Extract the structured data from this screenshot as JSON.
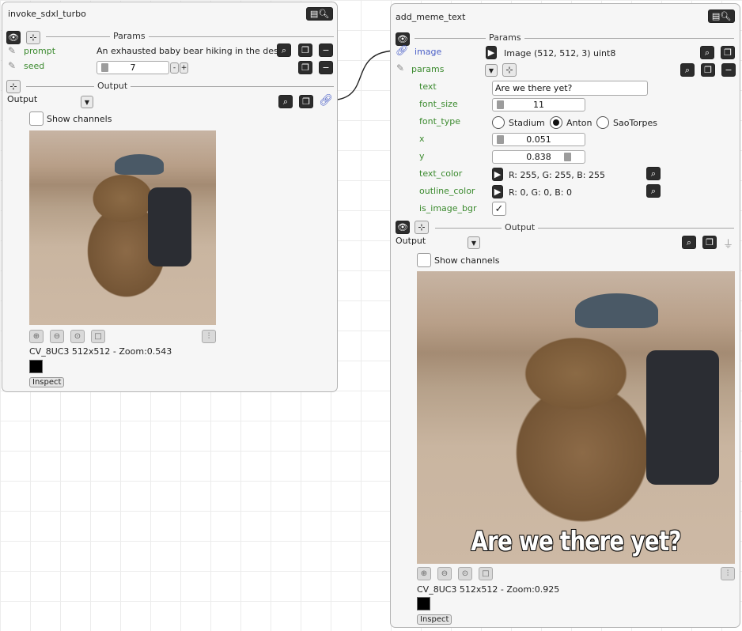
{
  "link_icon": "chain-link-icon",
  "node1": {
    "title": "invoke_sdxl_turbo",
    "params_section": "Params",
    "prompt_label": "prompt",
    "prompt_value": "An exhausted baby bear hiking in the des...",
    "seed_label": "seed",
    "seed_value": "7",
    "output_section": "Output",
    "output_label": "Output",
    "show_channels": "Show channels",
    "image_info": "CV_8UC3 512x512 - Zoom:0.543",
    "inspect": "Inspect"
  },
  "node2": {
    "title": "add_meme_text",
    "params_section": "Params",
    "image_label": "image",
    "image_value": "Image (512, 512, 3) uint8",
    "params_label": "params",
    "text_label": "text",
    "text_value": "Are we there yet?",
    "font_size_label": "font_size",
    "font_size_value": "11",
    "font_type_label": "font_type",
    "font_options": [
      "Stadium",
      "Anton",
      "SaoTorpes"
    ],
    "font_selected": "Anton",
    "x_label": "x",
    "x_value": "0.051",
    "y_label": "y",
    "y_value": "0.838",
    "text_color_label": "text_color",
    "text_color_value": "R: 255, G: 255, B: 255",
    "outline_color_label": "outline_color",
    "outline_color_value": "R: 0, G: 0, B: 0",
    "is_image_bgr_label": "is_image_bgr",
    "is_image_bgr_checked": true,
    "output_section": "Output",
    "output_label": "Output",
    "show_channels": "Show channels",
    "meme_text": "Are we there yet?",
    "image_info": "CV_8UC3 512x512 - Zoom:0.925",
    "inspect": "Inspect"
  },
  "colors": {
    "param_label": "#3b8a2e",
    "linked_label": "#4a5fc7"
  }
}
